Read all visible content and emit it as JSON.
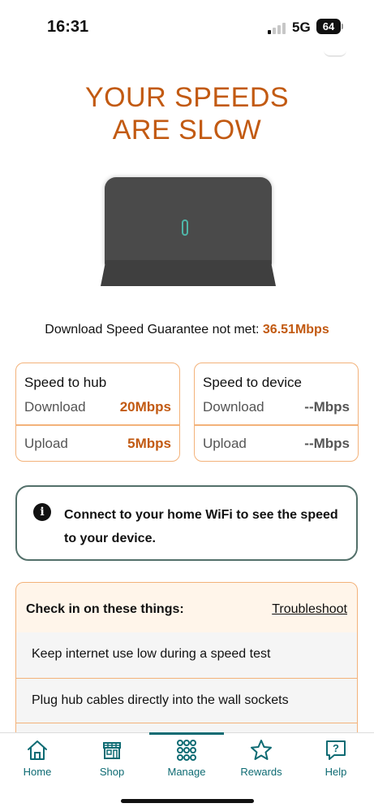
{
  "status_bar": {
    "time": "16:31",
    "network": "5G",
    "battery": "64"
  },
  "headline": {
    "line1": "YOUR SPEEDS",
    "line2": "ARE SLOW"
  },
  "guarantee": {
    "text": "Download Speed Guarantee not met: ",
    "value": "36.51Mbps"
  },
  "hub_card": {
    "title": "Speed to hub",
    "download_label": "Download",
    "download_value": "20Mbps",
    "upload_label": "Upload",
    "upload_value": "5Mbps"
  },
  "device_card": {
    "title": "Speed to device",
    "download_label": "Download",
    "download_value": "--Mbps",
    "upload_label": "Upload",
    "upload_value": "--Mbps"
  },
  "info": {
    "icon": "info-icon",
    "text": "Connect to your home WiFi to see the speed to your device."
  },
  "checks": {
    "title": "Check in on these things:",
    "link": "Troubleshoot",
    "items": [
      "Keep internet use low during a speed test",
      "Plug hub cables directly into the wall sockets"
    ]
  },
  "tabs": [
    {
      "label": "Home",
      "icon": "home-icon"
    },
    {
      "label": "Shop",
      "icon": "shop-icon"
    },
    {
      "label": "Manage",
      "icon": "grid-icon",
      "active": true
    },
    {
      "label": "Rewards",
      "icon": "star-icon"
    },
    {
      "label": "Help",
      "icon": "help-icon"
    }
  ],
  "colors": {
    "accent": "#c25a12",
    "brand": "#0e6b73",
    "card_border": "#f3b27a"
  }
}
